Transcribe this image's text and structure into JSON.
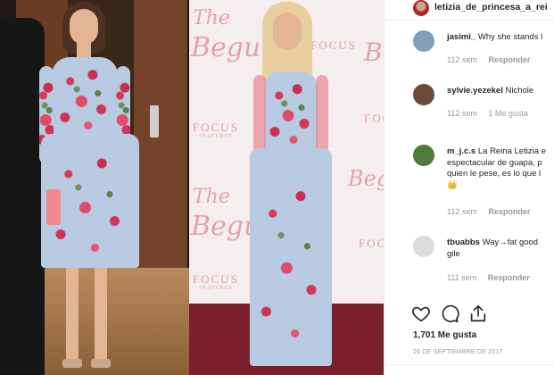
{
  "post": {
    "username": "letizia_de_princesa_a_rei",
    "likes": "1,701 Me gusta",
    "date": "26 DE SEPTIEMBRE DE 2017"
  },
  "photo": {
    "wall_text_1": "The",
    "wall_text_2": "Beguiled",
    "wall_text_3": "The",
    "wall_text_4": "Beguiled",
    "focus_1": "FOCUS",
    "focus_1_sub": "FEATURES",
    "focus_2": "FOCUS",
    "focus_2_sub": "FEATURES",
    "focus_3": "FOCUS",
    "focus_4": "FOCUS",
    "focus_5": "FOCUS",
    "side_b_1": "B",
    "side_b_2": "Beg"
  },
  "comments": [
    {
      "user": "jasimi_",
      "text": "Why she stands l",
      "time": "112 sem",
      "likes": "",
      "reply": "Responder",
      "avatar_color": "#7ea1b8"
    },
    {
      "user": "sylvie.yezekel",
      "text": "Nichole",
      "time": "112 sem",
      "likes": "1 Me gusta",
      "reply": "Responder",
      "avatar_color": "#6b4a3a"
    },
    {
      "user": "m_j.c.s",
      "text": "La Reina Letizia e",
      "text2": "espectacular de guapa, p",
      "text3": "quien le pese, es lo que l",
      "text4": "👑",
      "time": "112 sem",
      "likes": "",
      "reply": "Responder",
      "avatar_color": "#4f7a3a"
    },
    {
      "user": "tbuabbs",
      "text": "Way→fat good",
      "text2": "gile",
      "time": "111 sem",
      "likes": "",
      "reply": "Responder",
      "avatar_color": "#dcdcdc"
    }
  ],
  "icons": [
    "heart-icon",
    "comment-icon",
    "share-icon"
  ],
  "colors": {
    "accent_text": "#262626",
    "muted": "#999999",
    "border": "#efefef",
    "carpet": "#7a1f2c"
  }
}
